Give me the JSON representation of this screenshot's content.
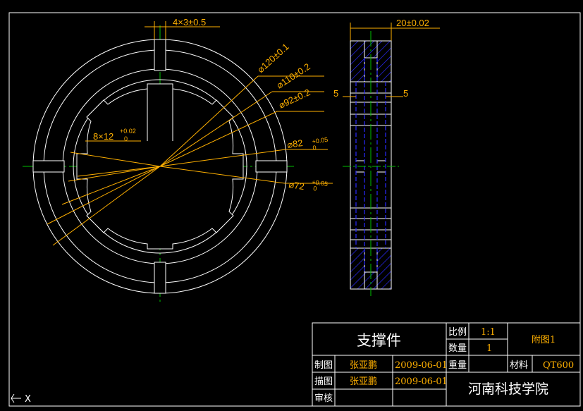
{
  "front_view": {
    "keyway_dim": "4×3±0.5",
    "spline_dim": "8×12",
    "spline_tol_upper": "+0.02",
    "spline_tol_lower": "0",
    "dia_120": "⌀120±0.1",
    "dia_110": "⌀110±0.2",
    "dia_92": "⌀92±0.2",
    "dia_82": "⌀82",
    "dia_82_tol_upper": "+0.05",
    "dia_82_tol_lower": "0",
    "dia_72": "⌀72",
    "dia_72_tol_upper": "+0.05",
    "dia_72_tol_lower": "0"
  },
  "side_view": {
    "width_dim": "20±0.02",
    "left_dim": "5",
    "right_dim": "5"
  },
  "title_block": {
    "part_name": "支撑件",
    "scale_label": "比例",
    "scale_value": "1:1",
    "qty_label": "数量",
    "qty_value": "1",
    "drawing_no": "附图1",
    "drawn_label": "制图",
    "drawn_by": "张亚鹏",
    "drawn_date": "2009-06-01",
    "weight_label": "重量",
    "material_label": "材料",
    "material_value": "QT600",
    "traced_label": "描图",
    "traced_by": "张亚鹏",
    "traced_date": "2009-06-01",
    "review_label": "审核",
    "school": "河南科技学院"
  },
  "ucs": {
    "x_label": "X"
  },
  "colors": {
    "background": "#000000",
    "outline": "#ffffff",
    "dimension": "#ffb000",
    "centerline": "#00c000",
    "hatch": "#0000ff",
    "hidden": "#0000ff"
  }
}
